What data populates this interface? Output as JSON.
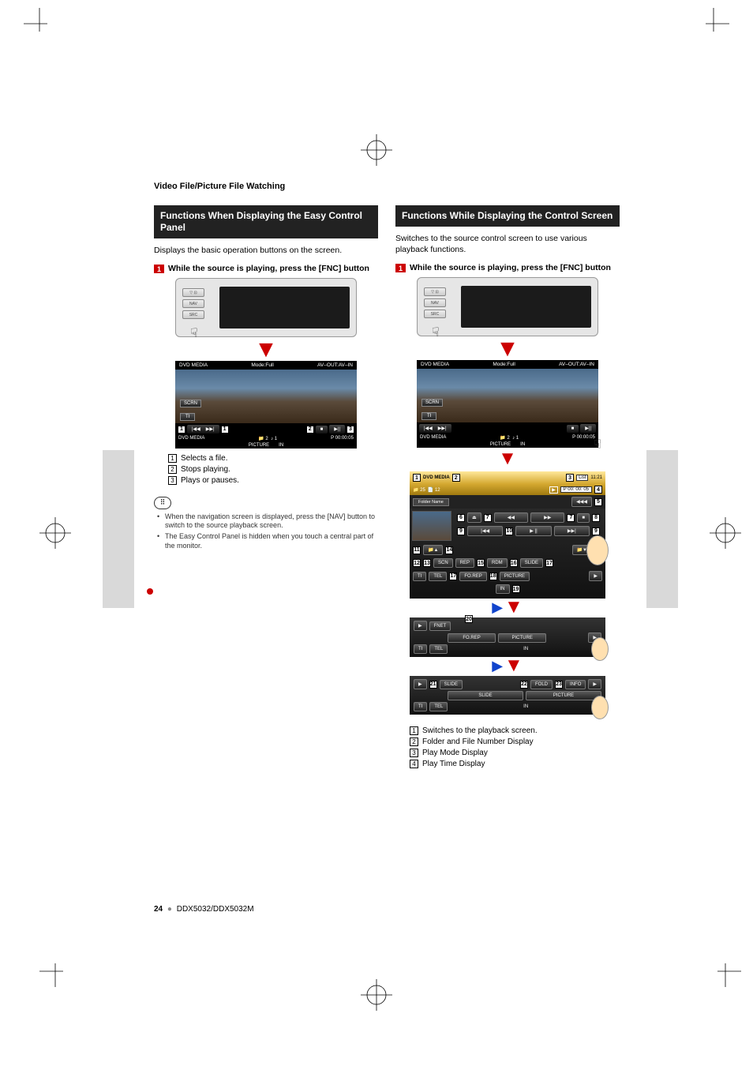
{
  "section_label": "Video File/Picture File Watching",
  "left": {
    "header": "Functions When Displaying the Easy Control Panel",
    "desc": "Displays the basic operation buttons on the screen.",
    "step_num": "1",
    "step_text": "While the source is playing, press the [FNC] button",
    "device_tabs": [
      "NAV",
      "SRC"
    ],
    "playback": {
      "top_left": "DVD MEDIA",
      "top_mid": "Mode:Full",
      "top_right": "AV–OUT:AV–IN",
      "scrn": "SCRN",
      "ti": "TI",
      "bottom_label": "DVD MEDIA",
      "track_disc": "2",
      "track_no": "1",
      "time": "P 00:00:05",
      "sub1": "PICTURE",
      "sub2": "IN"
    },
    "legend": [
      {
        "n": "1",
        "t": "Selects a file."
      },
      {
        "n": "2",
        "t": "Stops playing."
      },
      {
        "n": "3",
        "t": "Plays or pauses."
      }
    ],
    "notes": [
      "When the navigation screen is displayed, press the [NAV] button to switch to the source playback screen.",
      "The Easy Control Panel is hidden when you touch a central part of the monitor."
    ]
  },
  "right": {
    "header": "Functions While Displaying the Control Screen",
    "desc": "Switches to the source control screen to use various playback functions.",
    "step_num": "1",
    "step_text": "While the source is playing, press the [FNC] button",
    "device_tabs": [
      "NAV",
      "SRC"
    ],
    "playback": {
      "top_left": "DVD MEDIA",
      "top_mid": "Mode:Full",
      "top_right": "AV–OUT:AV–IN",
      "scrn": "SCRN",
      "ti": "TI",
      "bottom_label": "DVD MEDIA",
      "track_disc": "2",
      "track_no": "1",
      "time": "P 00:00:05",
      "sub1": "PICTURE",
      "sub2": "IN"
    },
    "control": {
      "title_left": "DVD MEDIA",
      "list": "List",
      "clock": "11:21",
      "folder_count": "25",
      "file_count": "12",
      "p_time": "P  00: 00: 05",
      "folder_label": "Folder Name",
      "buttons_row2": [
        "◀◀",
        "▶▶"
      ],
      "buttons_row3": [
        "|◀◀",
        "▶ ||",
        "▶▶|"
      ],
      "buttons_row4_labels": [
        "SCN",
        "REP",
        "RDM",
        "SLIDE"
      ],
      "buttons_row5_labels": [
        "FO.REP",
        "PICTURE"
      ],
      "ti": "TI",
      "tel": "TEL",
      "in": "IN"
    },
    "strip1": {
      "fn": "FNET",
      "b1": "FO.REP",
      "b2": "PICTURE",
      "ti": "TI",
      "tel": "TEL",
      "in": "IN"
    },
    "strip2": {
      "slide": "SLIDE",
      "b1": "SLIDE",
      "fold": "FOLD",
      "info": "INFO",
      "b2": "PICTURE",
      "ti": "TI",
      "tel": "TEL",
      "in": "IN"
    },
    "legend": [
      {
        "n": "1",
        "t": "Switches to the playback screen."
      },
      {
        "n": "2",
        "t": "Folder and File Number Display"
      },
      {
        "n": "3",
        "t": "Play Mode Display"
      },
      {
        "n": "4",
        "t": "Play Time Display"
      }
    ],
    "callouts_control": [
      "1",
      "2",
      "3",
      "4",
      "5",
      "6",
      "7",
      "8",
      "9",
      "10",
      "11",
      "12",
      "13",
      "14",
      "15",
      "16",
      "17",
      "18",
      "19"
    ],
    "callouts_strip1": [
      "20"
    ],
    "callouts_strip2": [
      "21",
      "22",
      "23"
    ]
  },
  "footer": {
    "page": "24",
    "model": "DDX5032/DDX5032M"
  }
}
